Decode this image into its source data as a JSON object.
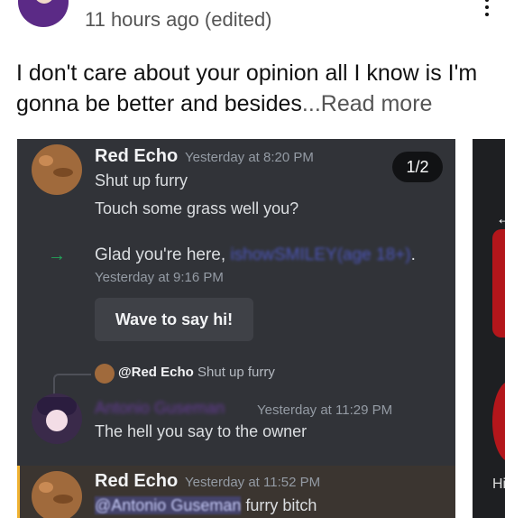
{
  "post": {
    "timestamp": "11 hours ago (edited)",
    "text": "I don't care about your opinion all I know is I'm gonna be better and besides",
    "ellipsis": "...",
    "read_more": "Read more"
  },
  "discord": {
    "image_counter": "1/2",
    "messages": [
      {
        "author": "Red Echo",
        "time": "Yesterday at 8:20 PM",
        "lines": [
          "Shut up furry",
          "Touch some grass well you?"
        ]
      },
      {
        "system_text": "Glad you're here,",
        "mention": "ishowSMILEY(age 18+)",
        "suffix": ".",
        "time": "Yesterday at 9:16 PM",
        "wave_button": "Wave to say hi!"
      },
      {
        "reply_to_user": "@Red Echo",
        "reply_to_text": "Shut up furry",
        "author": "Antonio Guseman",
        "time": "Yesterday at 11:29 PM",
        "lines": [
          "The hell you say to the owner"
        ]
      },
      {
        "author": "Red Echo",
        "time": "Yesterday at 11:52 PM",
        "mention": "@Antonio Guseman",
        "text": "furry bitch"
      }
    ]
  },
  "side_card": {
    "text": "Hi"
  }
}
